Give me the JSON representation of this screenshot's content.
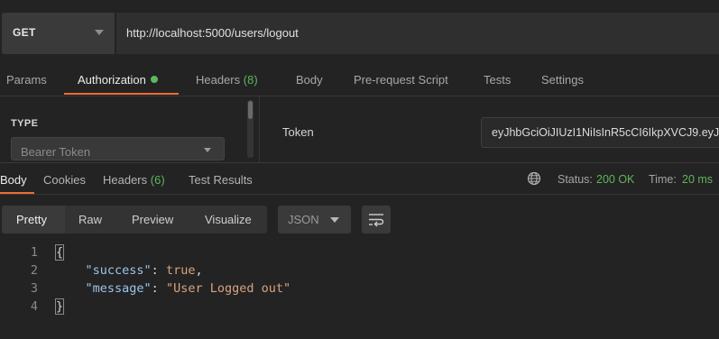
{
  "request": {
    "method": "GET",
    "url": "http://localhost:5000/users/logout"
  },
  "request_tabs": [
    {
      "label": "Params"
    },
    {
      "label": "Authorization"
    },
    {
      "label": "Headers",
      "count": "(8)"
    },
    {
      "label": "Body"
    },
    {
      "label": "Pre-request Script"
    },
    {
      "label": "Tests"
    },
    {
      "label": "Settings"
    }
  ],
  "auth": {
    "type_heading": "TYPE",
    "type_value": "Bearer Token",
    "token_label": "Token",
    "token_value": "eyJhbGciOiJIUzI1NiIsInR5cCI6IkpXVCJ9.eyJ"
  },
  "response_tabs": [
    {
      "label": "Body"
    },
    {
      "label": "Cookies"
    },
    {
      "label": "Headers",
      "count": "(6)"
    },
    {
      "label": "Test Results"
    }
  ],
  "status": {
    "status_label": "Status:",
    "status_value": "200 OK",
    "time_label": "Time:",
    "time_value": "20 ms"
  },
  "format_buttons": [
    "Pretty",
    "Raw",
    "Preview",
    "Visualize"
  ],
  "format_select": "JSON",
  "code": {
    "line_numbers": [
      "1",
      "2",
      "3",
      "4"
    ],
    "open_brace": "{",
    "close_brace": "}",
    "key1": "\"success\"",
    "val1": "true",
    "key2": "\"message\"",
    "val2": "\"User Logged out\"",
    "colon": ": ",
    "comma": ","
  },
  "colors": {
    "accent": "#ef6c35",
    "ok": "#5fb65a",
    "background": "#232323"
  }
}
